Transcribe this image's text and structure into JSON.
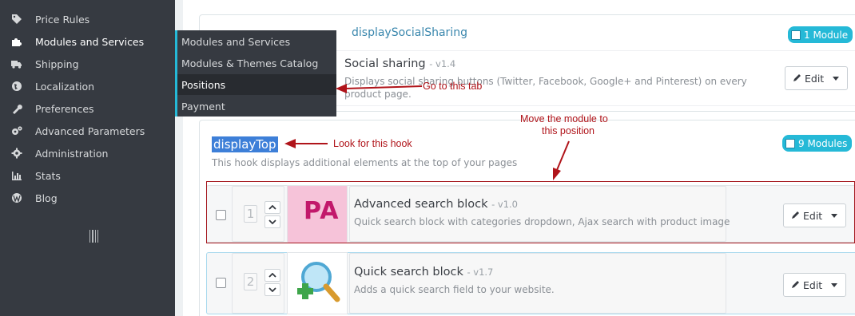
{
  "sidebar": {
    "items": [
      {
        "label": "Price Rules",
        "icon": "tag-icon"
      },
      {
        "label": "Modules and Services",
        "icon": "puzzle-icon"
      },
      {
        "label": "Shipping",
        "icon": "truck-icon"
      },
      {
        "label": "Localization",
        "icon": "globe-icon"
      },
      {
        "label": "Preferences",
        "icon": "wrench-icon"
      },
      {
        "label": "Advanced Parameters",
        "icon": "cogs-icon"
      },
      {
        "label": "Administration",
        "icon": "gear-icon"
      },
      {
        "label": "Stats",
        "icon": "bar-chart-icon"
      },
      {
        "label": "Blog",
        "icon": "wordpress-icon"
      }
    ]
  },
  "submenu": {
    "items": [
      "Modules and Services",
      "Modules & Themes Catalog",
      "Positions",
      "Payment"
    ]
  },
  "hook_social": {
    "name": "displaySocialSharing",
    "badge": "1 Module",
    "module": {
      "title": "Social sharing",
      "version": "- v1.4",
      "desc_line1": "Displays social sharing buttons (Twitter, Facebook, Google+ and Pinterest) on every",
      "desc_line2": "product page.",
      "edit_label": "Edit"
    }
  },
  "hook_top": {
    "name": "displayTop",
    "badge": "9 Modules",
    "description": "This hook displays additional elements at the top of your pages",
    "modules": [
      {
        "position": "1",
        "logo_text": "PA",
        "title": "Advanced search block",
        "version": "- v1.0",
        "desc": "Quick search block with categories dropdown, Ajax search with product image",
        "edit_label": "Edit"
      },
      {
        "position": "2",
        "title": "Quick search block",
        "version": "- v1.7",
        "desc": "Adds a quick search field to your website.",
        "edit_label": "Edit"
      }
    ]
  },
  "annotations": {
    "go_to_tab": "Go to this tab",
    "look_hook": "Look for this hook",
    "move_line1": "Move the module to",
    "move_line2": "this position"
  },
  "colors": {
    "sidebar_bg": "#363a41",
    "accent": "#25b9d7",
    "annotation": "#b0141a",
    "hook_title": "#3a87ad"
  }
}
